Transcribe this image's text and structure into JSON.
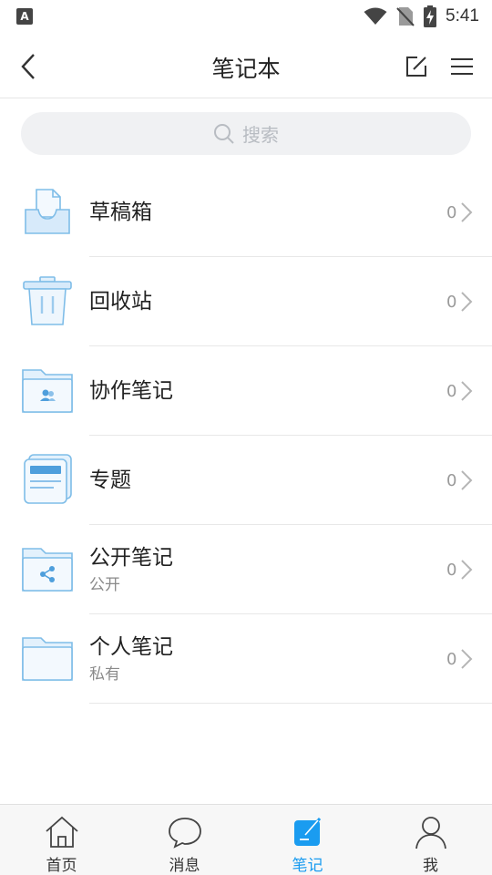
{
  "status_bar": {
    "badge": "A",
    "time": "5:41",
    "icons": [
      "wifi-icon",
      "no-sim-icon",
      "battery-charging-icon"
    ]
  },
  "nav": {
    "title": "笔记本",
    "icons": [
      "back-chevron-icon",
      "edit-icon",
      "menu-icon"
    ]
  },
  "search": {
    "placeholder": "搜索",
    "icon": "search-icon"
  },
  "list": [
    {
      "id": "drafts",
      "title": "草稿箱",
      "subtitle": "",
      "count": "0",
      "icon": "draft-tray-icon"
    },
    {
      "id": "trash",
      "title": "回收站",
      "subtitle": "",
      "count": "0",
      "icon": "trash-bin-icon"
    },
    {
      "id": "collab",
      "title": "协作笔记",
      "subtitle": "",
      "count": "0",
      "icon": "collab-folder-icon"
    },
    {
      "id": "topics",
      "title": "专题",
      "subtitle": "",
      "count": "0",
      "icon": "topic-icon"
    },
    {
      "id": "public",
      "title": "公开笔记",
      "subtitle": "公开",
      "count": "0",
      "icon": "share-folder-icon"
    },
    {
      "id": "private",
      "title": "个人笔记",
      "subtitle": "私有",
      "count": "0",
      "icon": "folder-icon"
    }
  ],
  "tabs": [
    {
      "id": "home",
      "label": "首页",
      "icon": "home-icon",
      "active": false
    },
    {
      "id": "messages",
      "label": "消息",
      "icon": "chat-bubble-icon",
      "active": false
    },
    {
      "id": "notes",
      "label": "笔记",
      "icon": "note-icon",
      "active": true
    },
    {
      "id": "me",
      "label": "我",
      "icon": "person-icon",
      "active": false
    }
  ],
  "colors": {
    "accent": "#1a9cf0",
    "icon_fill": "#e3f1fc",
    "icon_stroke": "#7fbde8"
  }
}
